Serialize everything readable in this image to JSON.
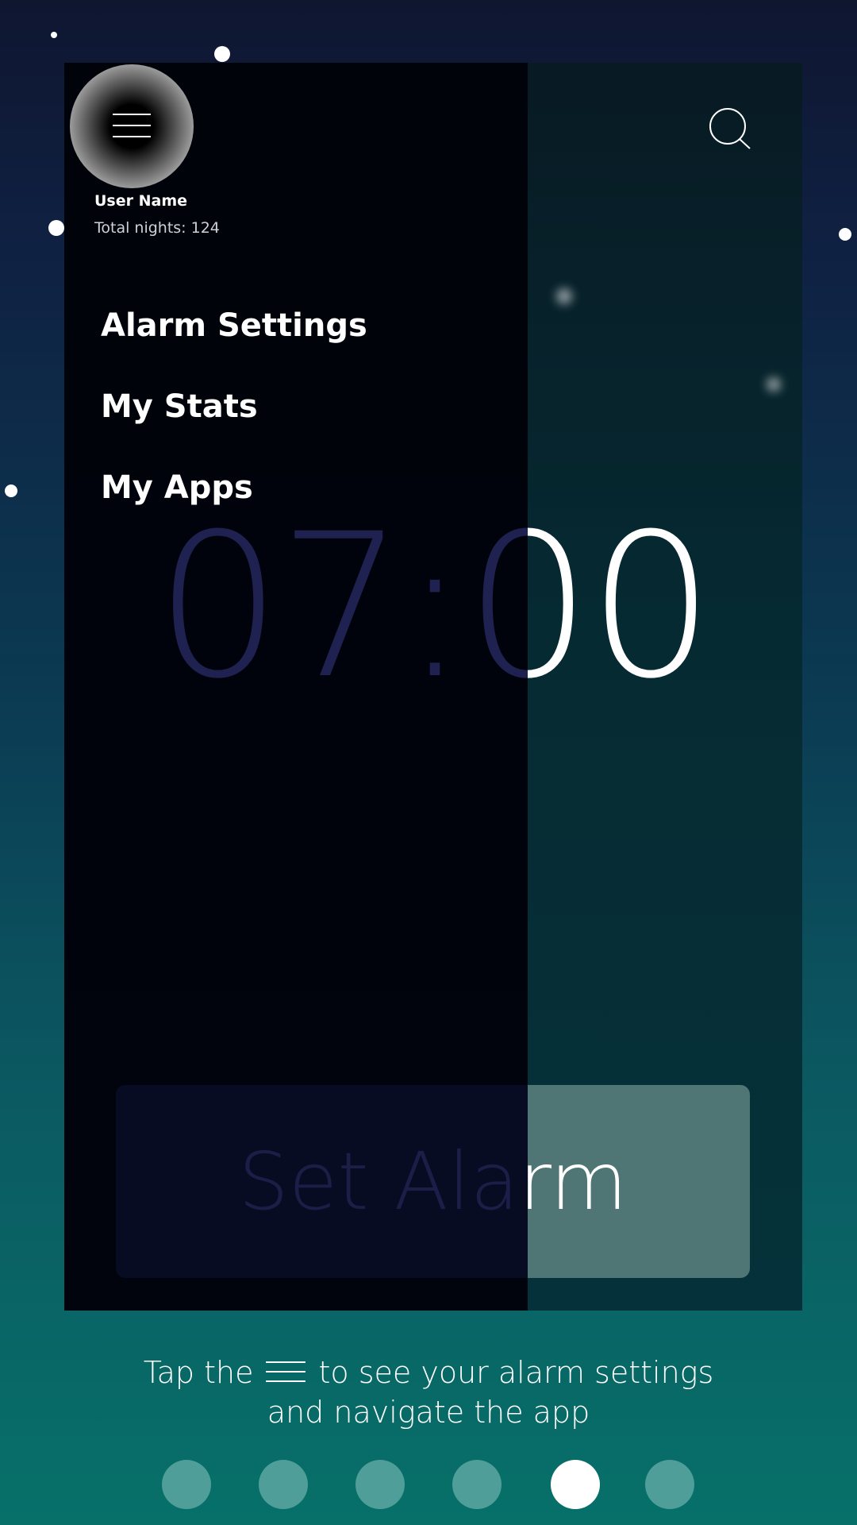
{
  "drawer": {
    "user_name": "User Name",
    "total_nights": "Total nights: 124",
    "menu": [
      {
        "label": "Alarm Settings"
      },
      {
        "label": "My Stats"
      },
      {
        "label": "My Apps"
      }
    ]
  },
  "main": {
    "time": "07:00",
    "set_alarm_label": "Set Alarm"
  },
  "hint": {
    "line1_before": "Tap the",
    "line1_after": "to see your alarm settings",
    "line2": "and navigate the app"
  },
  "pager": {
    "count": 6,
    "active_index": 4
  },
  "colors": {
    "accent_teal": "#4f9e9a",
    "button_bg": "#4f7574",
    "drawer_bg": "#01020a"
  },
  "icons": [
    "menu-icon",
    "search-icon"
  ]
}
